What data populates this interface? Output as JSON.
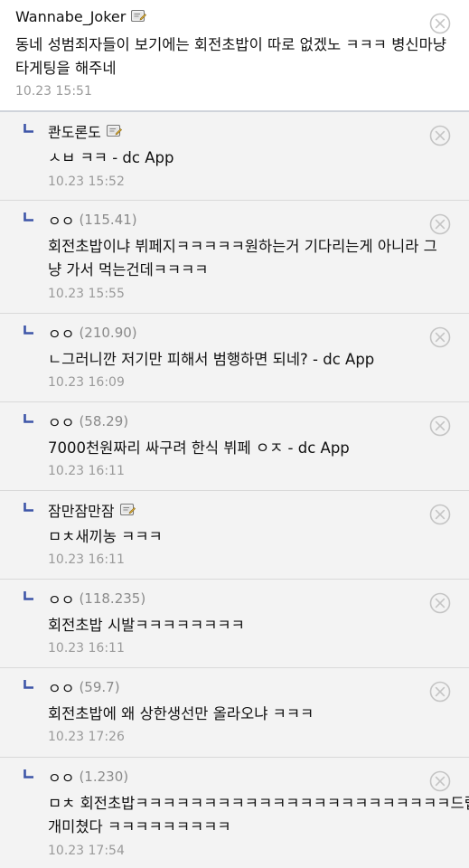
{
  "comments": [
    {
      "type": "top",
      "nick": "Wannabe_Joker",
      "ip": "",
      "gallog": true,
      "lines": [
        "동네 성범죄자들이 보기에는 회전초밥이 따로 없겠노 ㅋㅋㅋ 병신마냥",
        "타게팅을 해주네"
      ],
      "date": "10.23 15:51"
    },
    {
      "type": "reply",
      "nick": "콴도론도",
      "ip": "",
      "gallog": true,
      "lines": [
        "ㅅㅂ ㅋㅋ - dc App"
      ],
      "date": "10.23 15:52"
    },
    {
      "type": "reply",
      "nick": "ㅇㅇ",
      "ip": "(115.41)",
      "gallog": false,
      "lines": [
        "회전초밥이냐 뷔페지ㅋㅋㅋㅋㅋ원하는거 기다리는게 아니라 그",
        "냥 가서 먹는건데ㅋㅋㅋㅋ"
      ],
      "date": "10.23 15:55"
    },
    {
      "type": "reply",
      "nick": "ㅇㅇ",
      "ip": "(210.90)",
      "gallog": false,
      "lines": [
        "ㄴ그러니깐 저기만 피해서 범행하면 되네? - dc App"
      ],
      "date": "10.23 16:09"
    },
    {
      "type": "reply",
      "nick": "ㅇㅇ",
      "ip": "(58.29)",
      "gallog": false,
      "lines": [
        "7000천원짜리 싸구려 한식 뷔페 ㅇㅈ - dc App"
      ],
      "date": "10.23 16:11"
    },
    {
      "type": "reply",
      "nick": "잠만잠만잠",
      "ip": "",
      "gallog": true,
      "lines": [
        "ㅁㅊ새끼농 ㅋㅋㅋ"
      ],
      "date": "10.23 16:11"
    },
    {
      "type": "reply",
      "nick": "ㅇㅇ",
      "ip": "(118.235)",
      "gallog": false,
      "lines": [
        "회전초밥 시발ㅋㅋㅋㅋㅋㅋㅋㅋ"
      ],
      "date": "10.23 16:11"
    },
    {
      "type": "reply",
      "nick": "ㅇㅇ",
      "ip": "(59.7)",
      "gallog": false,
      "lines": [
        "회전초밥에 왜 상한생선만 올라오냐 ㅋㅋㅋ"
      ],
      "date": "10.23 17:26"
    },
    {
      "type": "reply",
      "nick": "ㅇㅇ",
      "ip": "(1.230)",
      "gallog": false,
      "lines": [
        "ㅁㅊ 회전초밥ㅋㅋㅋㅋㅋㅋㅋㅋㅋㅋㅋㅋㅋㅋㅋㅋㅋㅋㅋㅋㅋㅋㅋ드립",
        "개미쳤다 ㅋㅋㅋㅋㅋㅋㅋㅋㅋ"
      ],
      "date": "10.23 17:54"
    }
  ],
  "colors": {
    "reply_arrow": "#3d55a8",
    "reply_bg": "#f3f3f3",
    "meta_text": "#9a9a9a",
    "delete_icon": "#c4c4c4"
  },
  "icons": {
    "reply": "reply-arrow-icon",
    "gallog": "gallog-icon",
    "delete": "delete-circle-x-icon"
  }
}
